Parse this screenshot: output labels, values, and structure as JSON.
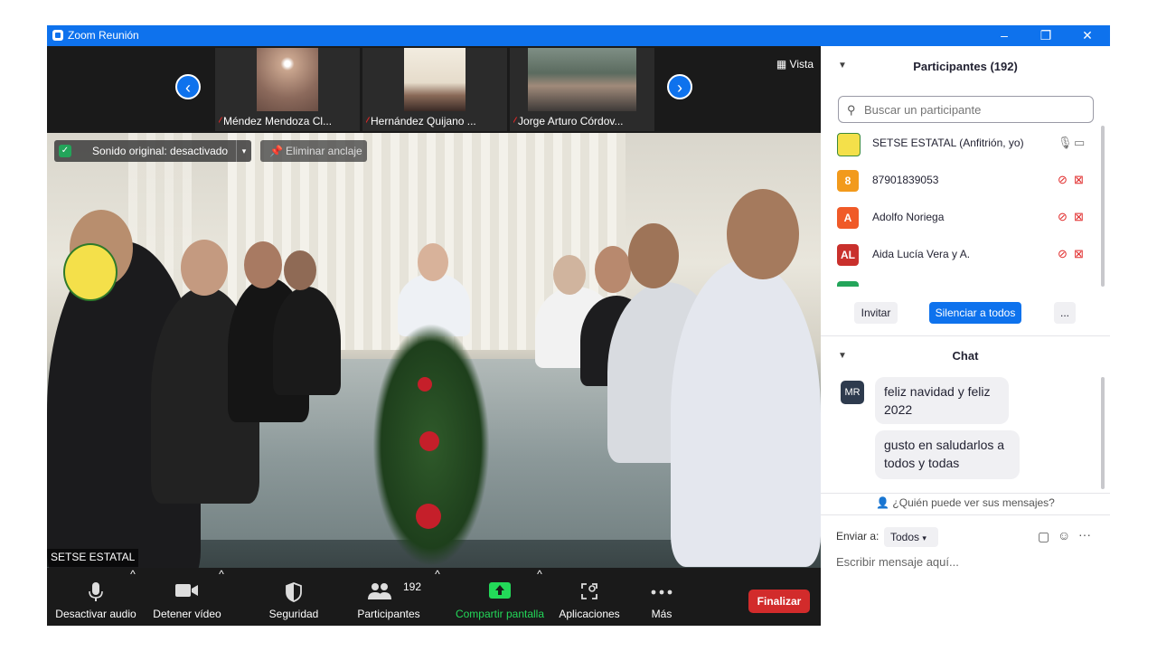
{
  "window": {
    "title": "Zoom Reunión",
    "controls": {
      "minimize": "–",
      "restore": "❐",
      "close": "✕"
    }
  },
  "thumbnails": [
    {
      "name": "Méndez Mendoza Cl..."
    },
    {
      "name": "Hernández Quijano ..."
    },
    {
      "name": "Jorge Arturo Córdov..."
    }
  ],
  "nav": {
    "prev": "‹",
    "next": "›"
  },
  "view": {
    "label": "Vista"
  },
  "main_video": {
    "original_sound": "Sonido original: desactivado",
    "unpin": "Eliminar anclaje",
    "name_label": "SETSE ESTATAL"
  },
  "toolbar": {
    "mute": "Desactivar audio",
    "stop_video": "Detener vídeo",
    "security": "Seguridad",
    "participants": "Participantes",
    "participants_count": "192",
    "share": "Compartir pantalla",
    "apps": "Aplicaciones",
    "more": "Más",
    "end": "Finalizar",
    "share_color": "#23d959",
    "end_color": "#d22b2b"
  },
  "participants_panel": {
    "title": "Participantes (192)",
    "search_placeholder": "Buscar un participante",
    "list": [
      {
        "initials": "",
        "name": "SETSE ESTATAL (Anfitrión, yo)",
        "color": "#f4e04a"
      },
      {
        "initials": "8",
        "name": "87901839053",
        "color": "#f29a1c"
      },
      {
        "initials": "A",
        "name": "Adolfo Noriega",
        "color": "#f05a28"
      },
      {
        "initials": "AL",
        "name": "Aida Lucía Vera y A.",
        "color": "#c9302c"
      }
    ],
    "invite": "Invitar",
    "mute_all": "Silenciar a todos",
    "more": "..."
  },
  "chat": {
    "title": "Chat",
    "sender_initials": "MR",
    "messages": [
      "feliz navidad y feliz 2022",
      "gusto en saludarlos a todos y todas"
    ],
    "who_can_see": "¿Quién puede ver sus mensajes?",
    "send_to_label": "Enviar a:",
    "send_to_value": "Todos",
    "input_placeholder": "Escribir mensaje aquí..."
  }
}
